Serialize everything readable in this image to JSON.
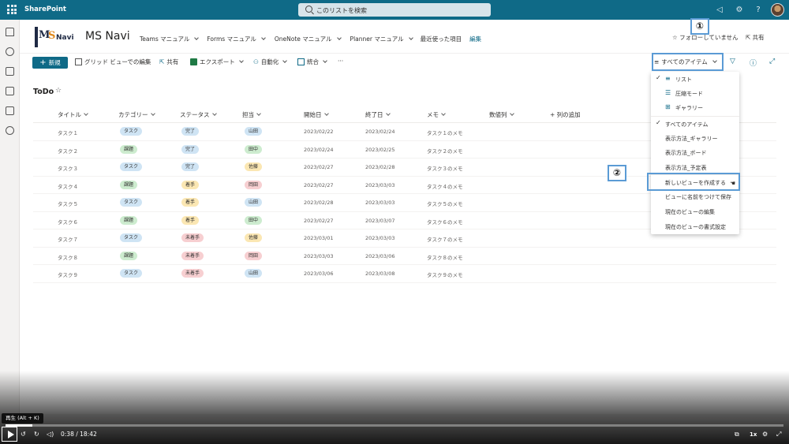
{
  "suitebar": {
    "brand": "SharePoint",
    "search_placeholder": "このリストを検索"
  },
  "site": {
    "title": "MS Navi",
    "logo_ms": "M",
    "logo_s": "S",
    "logo_navi": "Navi",
    "nav": [
      {
        "label": "Teams マニュアル"
      },
      {
        "label": "Forms マニュアル"
      },
      {
        "label": "OneNote マニュアル"
      },
      {
        "label": "Planner マニュアル"
      },
      {
        "label": "最近使った項目"
      }
    ],
    "edit": "編集",
    "follow": "☆ フォローしていません",
    "share": "共有"
  },
  "cmdbar": {
    "new": "新規",
    "grid_edit": "グリッド ビューでの編集",
    "share": "共有",
    "export": "エクスポート",
    "automate": "自動化",
    "integrate": "統合",
    "more": "···",
    "current_view": "すべてのアイテム"
  },
  "callouts": {
    "one": "①",
    "two": "②"
  },
  "list": {
    "title": "ToDo",
    "columns": [
      "タイトル",
      "カテゴリー",
      "ステータス",
      "担当",
      "開始日",
      "終了日",
      "メモ",
      "数値列",
      "+ 列の追加"
    ],
    "rows": [
      {
        "title": "タスク１",
        "category": "タスク",
        "status": "完了",
        "owner": "山田",
        "start": "2023/02/22",
        "end": "2023/02/24",
        "memo": "タスク１のメモ"
      },
      {
        "title": "タスク２",
        "category": "課題",
        "status": "完了",
        "owner": "田中",
        "start": "2023/02/24",
        "end": "2023/02/25",
        "memo": "タスク２のメモ"
      },
      {
        "title": "タスク３",
        "category": "タスク",
        "status": "完了",
        "owner": "佐藤",
        "start": "2023/02/27",
        "end": "2023/02/28",
        "memo": "タスク３のメモ"
      },
      {
        "title": "タスク４",
        "category": "課題",
        "status": "着手",
        "owner": "岡田",
        "start": "2023/02/27",
        "end": "2023/03/03",
        "memo": "タスク４のメモ"
      },
      {
        "title": "タスク５",
        "category": "タスク",
        "status": "着手",
        "owner": "山田",
        "start": "2023/02/28",
        "end": "2023/03/03",
        "memo": "タスク５のメモ"
      },
      {
        "title": "タスク６",
        "category": "課題",
        "status": "着手",
        "owner": "田中",
        "start": "2023/02/27",
        "end": "2023/03/07",
        "memo": "タスク６のメモ"
      },
      {
        "title": "タスク７",
        "category": "タスク",
        "status": "未着手",
        "owner": "佐藤",
        "start": "2023/03/01",
        "end": "2023/03/03",
        "memo": "タスク７のメモ"
      },
      {
        "title": "タスク８",
        "category": "課題",
        "status": "未着手",
        "owner": "岡田",
        "start": "2023/03/03",
        "end": "2023/03/06",
        "memo": "タスク８のメモ"
      },
      {
        "title": "タスク９",
        "category": "タスク",
        "status": "未着手",
        "owner": "山田",
        "start": "2023/03/06",
        "end": "2023/03/08",
        "memo": "タスク９のメモ"
      }
    ]
  },
  "pill_colors": {
    "タスク": "#cfe4f4",
    "課題": "#cdeccf",
    "完了": "#cfe4f4",
    "着手": "#fbe7b3",
    "未着手": "#f7cfd1",
    "山田": "#cfe4f4",
    "田中": "#cdeccf",
    "佐藤": "#fbe7b3",
    "岡田": "#f7cfd1"
  },
  "dropdown": {
    "list": "リスト",
    "compact": "圧縮モード",
    "gallery": "ギャラリー",
    "all_items": "すべてのアイテム",
    "gallery_view": "表示方法_ギャラリー",
    "board_view": "表示方法_ボード",
    "calendar_view": "表示方法_予定表",
    "new_view": "新しいビューを作成する",
    "save_as": "ビューに名前をつけて保存",
    "edit_view": "現在のビューの編集",
    "format_view": "現在のビューの書式設定"
  },
  "video": {
    "tooltip": "再生 (Alt + K)",
    "time": "0:38 / 18:42",
    "speed": "1x",
    "progress": 0.034
  }
}
